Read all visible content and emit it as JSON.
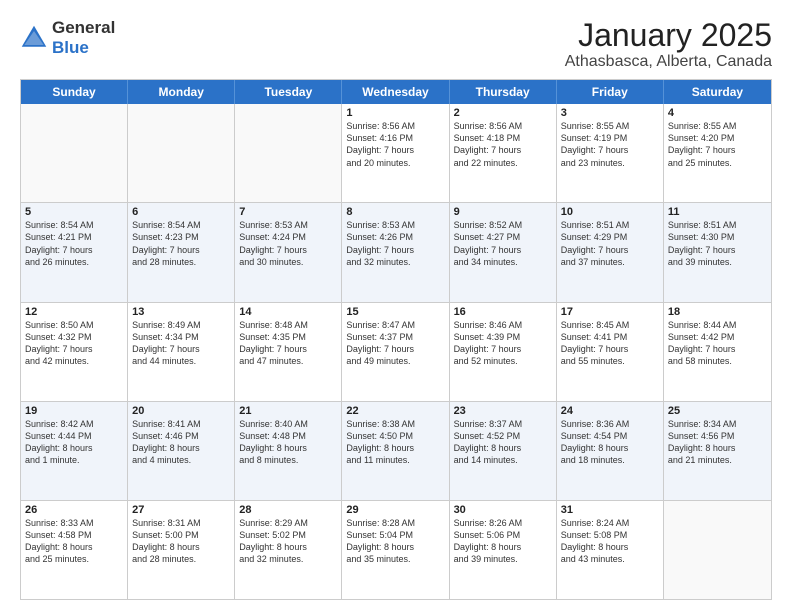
{
  "logo": {
    "general": "General",
    "blue": "Blue"
  },
  "title": {
    "month": "January 2025",
    "location": "Athasbasca, Alberta, Canada"
  },
  "header_days": [
    "Sunday",
    "Monday",
    "Tuesday",
    "Wednesday",
    "Thursday",
    "Friday",
    "Saturday"
  ],
  "rows": [
    {
      "alt": false,
      "cells": [
        {
          "day": "",
          "info": ""
        },
        {
          "day": "",
          "info": ""
        },
        {
          "day": "",
          "info": ""
        },
        {
          "day": "1",
          "info": "Sunrise: 8:56 AM\nSunset: 4:16 PM\nDaylight: 7 hours\nand 20 minutes."
        },
        {
          "day": "2",
          "info": "Sunrise: 8:56 AM\nSunset: 4:18 PM\nDaylight: 7 hours\nand 22 minutes."
        },
        {
          "day": "3",
          "info": "Sunrise: 8:55 AM\nSunset: 4:19 PM\nDaylight: 7 hours\nand 23 minutes."
        },
        {
          "day": "4",
          "info": "Sunrise: 8:55 AM\nSunset: 4:20 PM\nDaylight: 7 hours\nand 25 minutes."
        }
      ]
    },
    {
      "alt": true,
      "cells": [
        {
          "day": "5",
          "info": "Sunrise: 8:54 AM\nSunset: 4:21 PM\nDaylight: 7 hours\nand 26 minutes."
        },
        {
          "day": "6",
          "info": "Sunrise: 8:54 AM\nSunset: 4:23 PM\nDaylight: 7 hours\nand 28 minutes."
        },
        {
          "day": "7",
          "info": "Sunrise: 8:53 AM\nSunset: 4:24 PM\nDaylight: 7 hours\nand 30 minutes."
        },
        {
          "day": "8",
          "info": "Sunrise: 8:53 AM\nSunset: 4:26 PM\nDaylight: 7 hours\nand 32 minutes."
        },
        {
          "day": "9",
          "info": "Sunrise: 8:52 AM\nSunset: 4:27 PM\nDaylight: 7 hours\nand 34 minutes."
        },
        {
          "day": "10",
          "info": "Sunrise: 8:51 AM\nSunset: 4:29 PM\nDaylight: 7 hours\nand 37 minutes."
        },
        {
          "day": "11",
          "info": "Sunrise: 8:51 AM\nSunset: 4:30 PM\nDaylight: 7 hours\nand 39 minutes."
        }
      ]
    },
    {
      "alt": false,
      "cells": [
        {
          "day": "12",
          "info": "Sunrise: 8:50 AM\nSunset: 4:32 PM\nDaylight: 7 hours\nand 42 minutes."
        },
        {
          "day": "13",
          "info": "Sunrise: 8:49 AM\nSunset: 4:34 PM\nDaylight: 7 hours\nand 44 minutes."
        },
        {
          "day": "14",
          "info": "Sunrise: 8:48 AM\nSunset: 4:35 PM\nDaylight: 7 hours\nand 47 minutes."
        },
        {
          "day": "15",
          "info": "Sunrise: 8:47 AM\nSunset: 4:37 PM\nDaylight: 7 hours\nand 49 minutes."
        },
        {
          "day": "16",
          "info": "Sunrise: 8:46 AM\nSunset: 4:39 PM\nDaylight: 7 hours\nand 52 minutes."
        },
        {
          "day": "17",
          "info": "Sunrise: 8:45 AM\nSunset: 4:41 PM\nDaylight: 7 hours\nand 55 minutes."
        },
        {
          "day": "18",
          "info": "Sunrise: 8:44 AM\nSunset: 4:42 PM\nDaylight: 7 hours\nand 58 minutes."
        }
      ]
    },
    {
      "alt": true,
      "cells": [
        {
          "day": "19",
          "info": "Sunrise: 8:42 AM\nSunset: 4:44 PM\nDaylight: 8 hours\nand 1 minute."
        },
        {
          "day": "20",
          "info": "Sunrise: 8:41 AM\nSunset: 4:46 PM\nDaylight: 8 hours\nand 4 minutes."
        },
        {
          "day": "21",
          "info": "Sunrise: 8:40 AM\nSunset: 4:48 PM\nDaylight: 8 hours\nand 8 minutes."
        },
        {
          "day": "22",
          "info": "Sunrise: 8:38 AM\nSunset: 4:50 PM\nDaylight: 8 hours\nand 11 minutes."
        },
        {
          "day": "23",
          "info": "Sunrise: 8:37 AM\nSunset: 4:52 PM\nDaylight: 8 hours\nand 14 minutes."
        },
        {
          "day": "24",
          "info": "Sunrise: 8:36 AM\nSunset: 4:54 PM\nDaylight: 8 hours\nand 18 minutes."
        },
        {
          "day": "25",
          "info": "Sunrise: 8:34 AM\nSunset: 4:56 PM\nDaylight: 8 hours\nand 21 minutes."
        }
      ]
    },
    {
      "alt": false,
      "cells": [
        {
          "day": "26",
          "info": "Sunrise: 8:33 AM\nSunset: 4:58 PM\nDaylight: 8 hours\nand 25 minutes."
        },
        {
          "day": "27",
          "info": "Sunrise: 8:31 AM\nSunset: 5:00 PM\nDaylight: 8 hours\nand 28 minutes."
        },
        {
          "day": "28",
          "info": "Sunrise: 8:29 AM\nSunset: 5:02 PM\nDaylight: 8 hours\nand 32 minutes."
        },
        {
          "day": "29",
          "info": "Sunrise: 8:28 AM\nSunset: 5:04 PM\nDaylight: 8 hours\nand 35 minutes."
        },
        {
          "day": "30",
          "info": "Sunrise: 8:26 AM\nSunset: 5:06 PM\nDaylight: 8 hours\nand 39 minutes."
        },
        {
          "day": "31",
          "info": "Sunrise: 8:24 AM\nSunset: 5:08 PM\nDaylight: 8 hours\nand 43 minutes."
        },
        {
          "day": "",
          "info": ""
        }
      ]
    }
  ]
}
